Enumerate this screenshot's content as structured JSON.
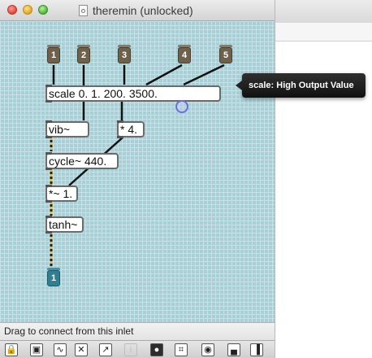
{
  "window": {
    "title": "theremin (unlocked)"
  },
  "patch": {
    "inlets": [
      {
        "label": "1"
      },
      {
        "label": "2"
      },
      {
        "label": "3"
      },
      {
        "label": "4"
      },
      {
        "label": "5"
      }
    ],
    "objects": {
      "scale": "scale 0. 1. 200. 3500.",
      "vib": "vib~",
      "mul4": "* 4.",
      "cycle": "cycle~ 440.",
      "sigmul": "*~ 1.",
      "tanh": "tanh~"
    },
    "outlet": {
      "label": "1"
    }
  },
  "tooltip": {
    "text": "scale: High Output Value"
  },
  "status": {
    "text": "Drag to connect from this inlet"
  },
  "toolbar": {
    "items": [
      {
        "name": "lock-icon"
      },
      {
        "name": "presentation-icon"
      },
      {
        "name": "patch-cords-icon"
      },
      {
        "name": "delete-icon"
      },
      {
        "name": "new-object-icon"
      },
      {
        "name": "inspector-icon"
      },
      {
        "name": "align-icon"
      },
      {
        "name": "grid-icon"
      },
      {
        "name": "snap-icon"
      },
      {
        "name": "split-view-icon"
      },
      {
        "name": "sidebar-icon"
      }
    ]
  }
}
